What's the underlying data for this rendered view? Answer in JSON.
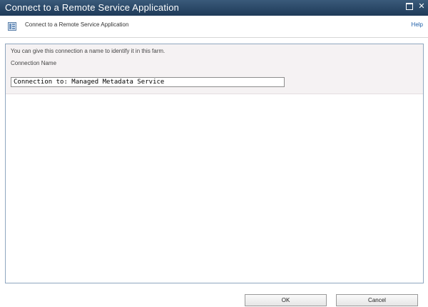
{
  "window": {
    "title": "Connect to a Remote Service Application"
  },
  "header": {
    "title": "Connect to a Remote Service Application",
    "help_label": "Help",
    "icon": "service-application-icon"
  },
  "form": {
    "description": "You can give this connection a name to identify it in this farm.",
    "connection_name_label": "Connection Name",
    "connection_name_value": "Connection to: Managed Metadata Service"
  },
  "buttons": {
    "ok_label": "OK",
    "cancel_label": "Cancel"
  },
  "colors": {
    "titlebar": "#2a4a6a",
    "link": "#1f5fa8",
    "section_background": "#f5f2f3",
    "panel_border": "#8fa6bf"
  }
}
